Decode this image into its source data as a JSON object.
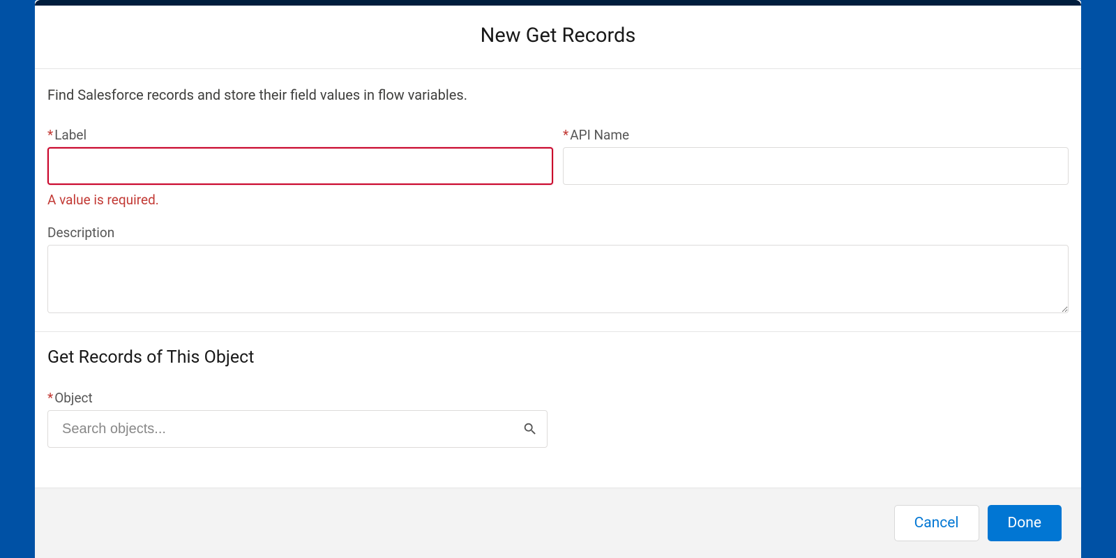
{
  "modal": {
    "title": "New Get Records",
    "intro": "Find Salesforce records and store their field values in flow variables."
  },
  "fields": {
    "label": {
      "label_text": "Label",
      "value": "",
      "error": "A value is required."
    },
    "api_name": {
      "label_text": "API Name",
      "value": ""
    },
    "description": {
      "label_text": "Description",
      "value": ""
    },
    "object": {
      "label_text": "Object",
      "placeholder": "Search objects...",
      "value": ""
    }
  },
  "section": {
    "heading": "Get Records of This Object"
  },
  "footer": {
    "cancel": "Cancel",
    "done": "Done"
  }
}
